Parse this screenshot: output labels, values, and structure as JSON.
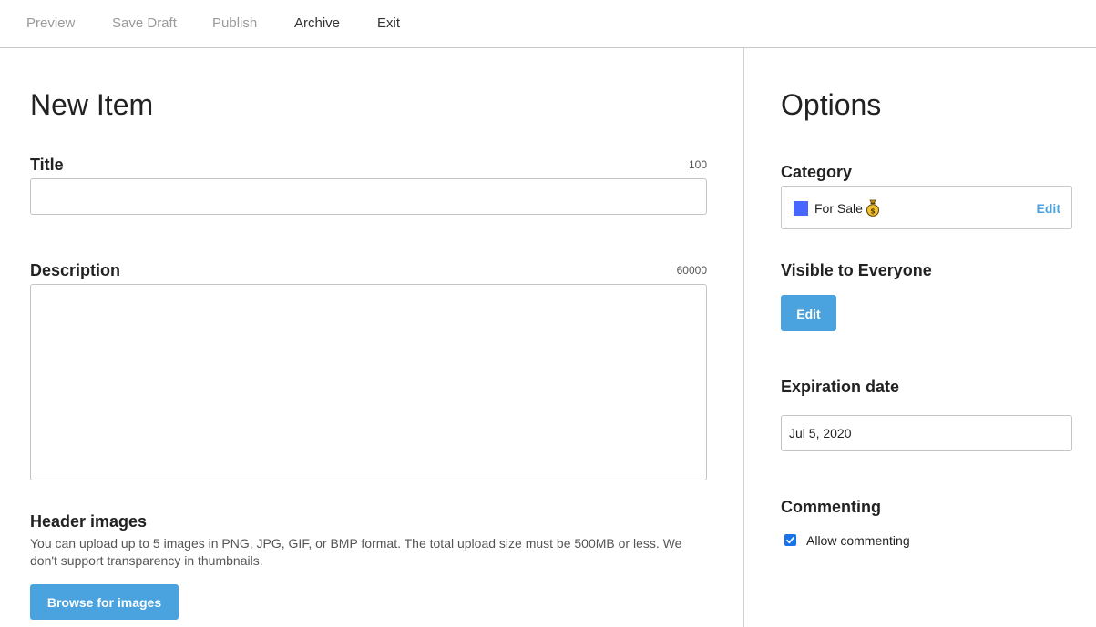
{
  "toolbar": {
    "preview": "Preview",
    "save_draft": "Save Draft",
    "publish": "Publish",
    "archive": "Archive",
    "exit": "Exit"
  },
  "main": {
    "title": "New Item",
    "title_field": {
      "label": "Title",
      "max_length": "100",
      "value": "",
      "placeholder": ""
    },
    "description_field": {
      "label": "Description",
      "max_length": "60000",
      "value": "",
      "placeholder": ""
    },
    "header_images": {
      "label": "Header images",
      "help": "You can upload up to 5 images in PNG, JPG, GIF, or BMP format. The total upload size must be 500MB or less. We don't support transparency in thumbnails.",
      "browse_label": "Browse for images"
    }
  },
  "options": {
    "title": "Options",
    "category": {
      "label": "Category",
      "name": "For Sale",
      "icon": "money-bag-icon",
      "color": "#4666ff",
      "edit_label": "Edit"
    },
    "visibility": {
      "label": "Visible to Everyone",
      "edit_label": "Edit"
    },
    "expiration": {
      "label": "Expiration date",
      "value": "Jul 5, 2020"
    },
    "commenting": {
      "label": "Commenting",
      "checkbox_label": "Allow commenting",
      "checked": true
    }
  },
  "colors": {
    "accent": "#4aa3df",
    "checkbox": "#1a73e8",
    "disabled_text": "#9a9a9a"
  }
}
